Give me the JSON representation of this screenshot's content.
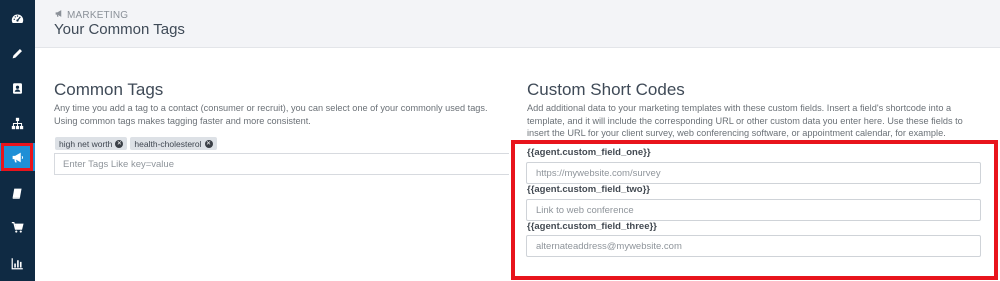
{
  "header": {
    "breadcrumb": "MARKETING",
    "title": "Your Common Tags"
  },
  "sidebar": {
    "items": [
      {
        "icon": "dashboard-icon"
      },
      {
        "icon": "pencil-icon"
      },
      {
        "icon": "contact-book-icon"
      },
      {
        "icon": "org-chart-icon"
      },
      {
        "icon": "megaphone-icon",
        "active": true
      },
      {
        "icon": "book-icon"
      },
      {
        "icon": "cart-icon"
      },
      {
        "icon": "bar-chart-icon"
      }
    ],
    "active_color": "#1e8fd6",
    "background": "#0f2a43"
  },
  "common_tags": {
    "title": "Common Tags",
    "description_line1": "Any time you add a tag to a contact (consumer or recruit), you can select one of your commonly used tags.",
    "description_line2": "Using common tags makes tagging faster and more consistent.",
    "tags": [
      "high net worth",
      "health-cholesterol"
    ],
    "input_placeholder": "Enter Tags Like key=value"
  },
  "custom_short_codes": {
    "title": "Custom Short Codes",
    "description_line1": "Add additional data to your marketing templates with these custom fields. Insert a field's shortcode into a",
    "description_line2": "template, and it will include the corresponding URL or other custom data you enter here. Use these fields to",
    "description_line3": "insert the URL for your client survey, web conferencing software, or appointment calendar, for example.",
    "fields": [
      {
        "label": "{{agent.custom_field_one}}",
        "placeholder": "https://mywebsite.com/survey"
      },
      {
        "label": "{{agent.custom_field_two}}",
        "placeholder": "Link to web conference"
      },
      {
        "label": "{{agent.custom_field_three}}",
        "placeholder": "alternateaddress@mywebsite.com"
      }
    ]
  },
  "highlight_color": "#e8141c"
}
